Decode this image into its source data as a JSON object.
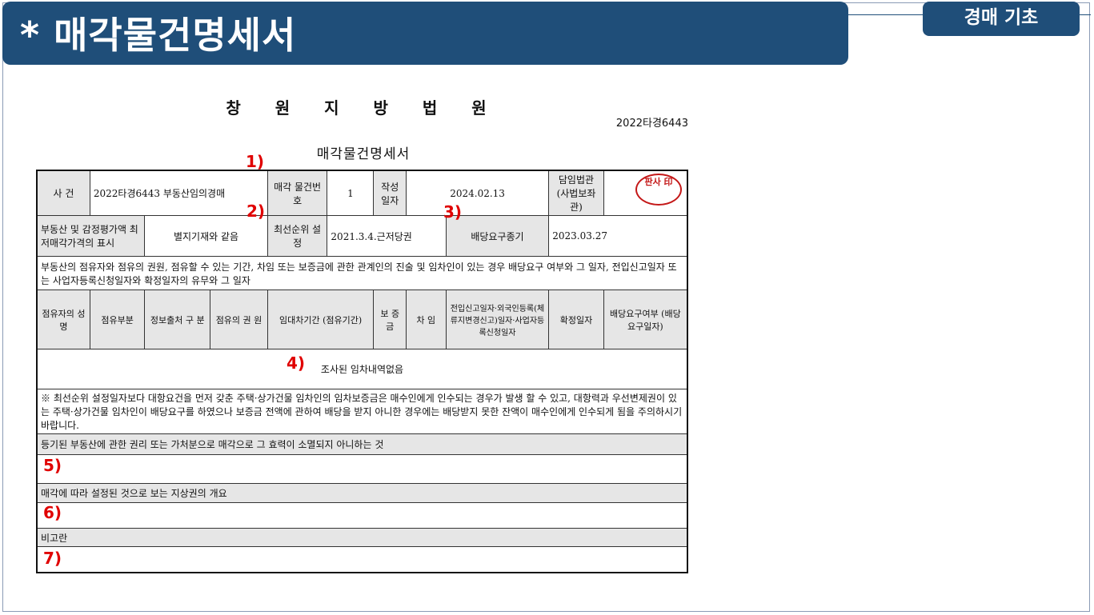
{
  "header": {
    "title": "* 매각물건명세서",
    "tag": "경매 기초"
  },
  "doc": {
    "court": "창 원 지 방 법 원",
    "case_number": "2022타경6443",
    "doc_title": "매각물건명세서",
    "row1": {
      "case_label": "사 건",
      "case_value": "2022타경6443 부동산임의경매",
      "item_no_label": "매각 물건번호",
      "item_no": "1",
      "written_label": "작성 일자",
      "written_date": "2024.02.13",
      "judge_label": "담임법관 (사법보좌관)"
    },
    "row2": {
      "property_label": "부동산 및 감정평가액 최저매각가격의 표시",
      "property_value": "별지기재와 같음",
      "priority_label": "최선순위 설정",
      "priority_value": "2021.3.4.근저당권",
      "deadline_label": "배당요구종기",
      "deadline_value": "2023.03.27"
    },
    "occupancy_note": "부동산의 점유자와 점유의 권원, 점유할 수 있는 기간, 차임 또는 보증금에 관한 관계인의 진술 및 임차인이 있는 경우 배당요구 여부와 그 일자, 전입신고일자 또는 사업자등록신청일자와 확정일자의 유무와 그 일자",
    "columns": [
      "점유자의 성 명",
      "점유부분",
      "정보출처 구 분",
      "점유의 권 원",
      "임대차기간 (점유기간)",
      "보 증 금",
      "차 임",
      "전입신고일자·외국인등록(체류지변경신고)일자·사업자등록신청일자",
      "확정일자",
      "배당요구여부 (배당요구일자)"
    ],
    "no_tenant": "조사된 임차내역없음",
    "warning": "※ 최선순위 설정일자보다 대항요건을 먼저 갖춘 주택·상가건물 임차인의 임차보증금은 매수인에게 인수되는 경우가 발생 할 수 있고, 대항력과 우선변제권이 있는 주택·상가건물 임차인이 배당요구를 하였으나 보증금 전액에 관하여 배당을 받지 아니한 경우에는 배당받지 못한 잔액이 매수인에게 인수되게 됨을 주의하시기 바랍니다.",
    "section5": "등기된 부동산에 관한 권리 또는 가처분으로 매각으로 그 효력이 소멸되지 아니하는 것",
    "section6": "매각에 따라 설정된 것으로 보는 지상권의 개요",
    "section7": "비고란",
    "seal_text": "판사 印"
  },
  "markers": {
    "m1": "1)",
    "m2": "2)",
    "m3": "3)",
    "m4": "4)",
    "m5": "5)",
    "m6": "6)",
    "m7": "7)"
  },
  "colors": {
    "header_bg": "#1f4e79",
    "marker": "#e00000",
    "seal": "#c41818"
  }
}
